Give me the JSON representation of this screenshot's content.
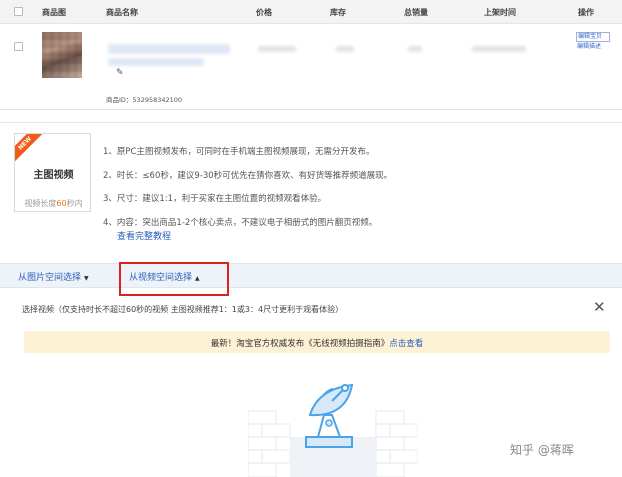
{
  "table_header": {
    "col_image": "商品图",
    "col_name": "商品名称",
    "col_price": "价格",
    "col_stock": "库存",
    "col_sales": "总销量",
    "col_time": "上架时间",
    "col_op": "操作"
  },
  "product": {
    "id_label": "商品ID：532958342100",
    "op_link1": "编辑宝贝",
    "op_link2": "编辑描述"
  },
  "video_card": {
    "badge": "NEW",
    "title": "主图视频",
    "subtitle_prefix": "视频长度",
    "subtitle_highlight": "60",
    "subtitle_suffix": "秒内"
  },
  "rules": [
    "1、原PC主图视频发布，可同时在手机端主图视频展现，无需分开发布。",
    "2、时长：≤60秒，建议9-30秒可优先在猜你喜欢、有好货等推荐频道展现。",
    "3、尺寸：建议1:1，利于买家在主图位置的视频观看体验。",
    "4、内容：突出商品1-2个核心卖点，不建议电子相册式的图片翻页视频。"
  ],
  "tutorial_link": "查看完整教程",
  "tabs": {
    "tab1": "从图片空间选择",
    "tab2": "从视频空间选择"
  },
  "select_video": {
    "label": "选择视频（仅支持时长不超过60秒的视频 主图视频推荐1：1或3：4尺寸更利于观看体验）"
  },
  "notice": {
    "prefix": "最新！淘宝官方权威发布《无线视频拍摄指南》",
    "link": "点击查看"
  },
  "watermark": "知乎 @蒋晖",
  "colors": {
    "accent_blue": "#2c5fb8",
    "highlight_red": "#d9241b",
    "new_badge": "#f05a1a",
    "notice_bg": "#fdf2d5"
  }
}
